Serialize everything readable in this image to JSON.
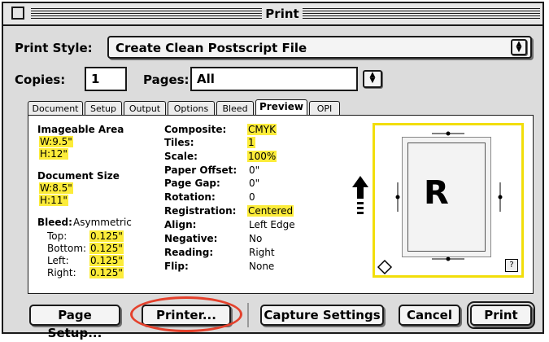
{
  "window": {
    "title": "Print"
  },
  "print_style": {
    "label": "Print Style:",
    "value": "Create Clean Postscript File"
  },
  "copies": {
    "label": "Copies:",
    "value": "1"
  },
  "pages": {
    "label": "Pages:",
    "value": "All"
  },
  "tabs": [
    "Document",
    "Setup",
    "Output",
    "Options",
    "Bleed",
    "Preview",
    "OPI"
  ],
  "active_tab": "Preview",
  "imageable_area": {
    "heading": "Imageable Area",
    "w": "W:9.5\"",
    "h": "H:12\""
  },
  "document_size": {
    "heading": "Document Size",
    "w": "W:8.5\"",
    "h": "H:11\""
  },
  "bleed": {
    "label": "Bleed:",
    "value": "Asymmetric",
    "rows": [
      {
        "label": "Top:",
        "value": "0.125\""
      },
      {
        "label": "Bottom:",
        "value": "0.125\""
      },
      {
        "label": "Left:",
        "value": "0.125\""
      },
      {
        "label": "Right:",
        "value": "0.125\""
      }
    ]
  },
  "settings": [
    {
      "label": "Composite:",
      "value": "CMYK",
      "highlight": true
    },
    {
      "label": "Tiles:",
      "value": "1",
      "highlight": true
    },
    {
      "label": "Scale:",
      "value": "100%",
      "highlight": true
    },
    {
      "label": "Paper Offset:",
      "value": "0\"",
      "highlight": false
    },
    {
      "label": "Page Gap:",
      "value": "0\"",
      "highlight": false
    },
    {
      "label": "Rotation:",
      "value": "0",
      "highlight": false
    },
    {
      "label": "Registration:",
      "value": "Centered",
      "highlight": true
    },
    {
      "label": "Align:",
      "value": "Left Edge",
      "highlight": false
    },
    {
      "label": "Negative:",
      "value": "No",
      "highlight": false
    },
    {
      "label": "Reading:",
      "value": "Right",
      "highlight": false
    },
    {
      "label": "Flip:",
      "value": "None",
      "highlight": false
    }
  ],
  "preview": {
    "letter": "R",
    "help": "?"
  },
  "buttons": {
    "page_setup": "Page Setup...",
    "printer": "Printer...",
    "capture_settings": "Capture Settings",
    "cancel": "Cancel",
    "print": "Print"
  },
  "colors": {
    "highlight": "#fcec3a",
    "annotation_circle": "#e4412c",
    "preview_border": "#f2de0a"
  },
  "icons": [
    "close-box-icon",
    "updown-arrows-icon",
    "feed-direction-arrow-icon",
    "rotate-page-icon",
    "help-icon"
  ]
}
